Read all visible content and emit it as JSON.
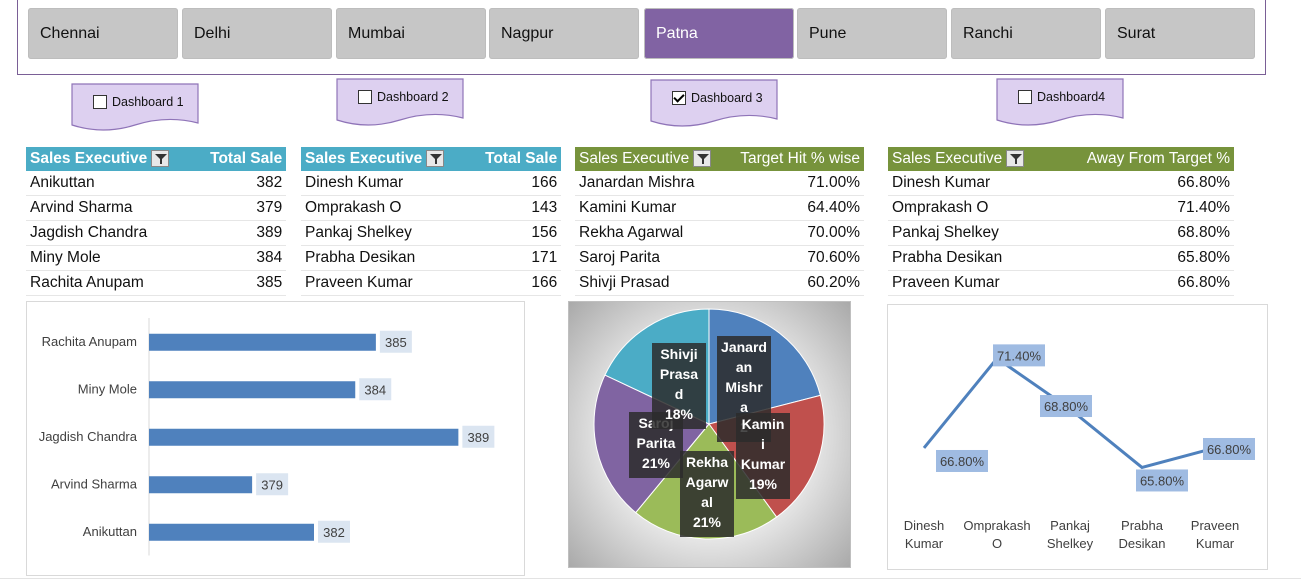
{
  "slicer": {
    "items": [
      "Chennai",
      "Delhi",
      "Mumbai",
      "Nagpur",
      "Patna",
      "Pune",
      "Ranchi",
      "Surat"
    ],
    "selected": "Patna",
    "selected_color": "#8163a3",
    "button_color": "#c6c6c6"
  },
  "dashboards": [
    {
      "label": "Dashboard 1",
      "checked": false
    },
    {
      "label": "Dashboard 2",
      "checked": false
    },
    {
      "label": "Dashboard 3",
      "checked": true
    },
    {
      "label": "Dashboard4",
      "checked": false
    }
  ],
  "tables": [
    {
      "header": [
        "Sales Executive",
        "Total Sale"
      ],
      "header_color": "#4bacc6",
      "rows": [
        [
          "Anikuttan",
          "382"
        ],
        [
          "Arvind Sharma",
          "379"
        ],
        [
          "Jagdish Chandra",
          "389"
        ],
        [
          "Miny Mole",
          "384"
        ],
        [
          "Rachita Anupam",
          "385"
        ]
      ]
    },
    {
      "header": [
        "Sales Executive",
        "Total Sale"
      ],
      "header_color": "#4bacc6",
      "rows": [
        [
          "Dinesh Kumar",
          "166"
        ],
        [
          "Omprakash O",
          "143"
        ],
        [
          "Pankaj Shelkey",
          "156"
        ],
        [
          "Prabha Desikan",
          "171"
        ],
        [
          "Praveen Kumar",
          "166"
        ]
      ]
    },
    {
      "header": [
        "Sales Executive",
        "Target Hit % wise"
      ],
      "header_color": "#77933c",
      "rows": [
        [
          "Janardan Mishra",
          "71.00%"
        ],
        [
          "Kamini Kumar",
          "64.40%"
        ],
        [
          "Rekha Agarwal",
          "70.00%"
        ],
        [
          "Saroj Parita",
          "70.60%"
        ],
        [
          "Shivji Prasad",
          "60.20%"
        ]
      ]
    },
    {
      "header": [
        "Sales Executive",
        "Away From Target %"
      ],
      "header_color": "#77933c",
      "rows": [
        [
          "Dinesh Kumar",
          "66.80%"
        ],
        [
          "Omprakash O",
          "71.40%"
        ],
        [
          "Pankaj Shelkey",
          "68.80%"
        ],
        [
          "Prabha Desikan",
          "65.80%"
        ],
        [
          "Praveen Kumar",
          "66.80%"
        ]
      ]
    }
  ],
  "chart_data": [
    {
      "type": "bar",
      "orientation": "horizontal",
      "categories": [
        "Rachita Anupam",
        "Miny Mole",
        "Jagdish Chandra",
        "Arvind Sharma",
        "Anikuttan"
      ],
      "values": [
        385,
        384,
        389,
        379,
        382
      ],
      "data_labels": [
        "385",
        "384",
        "389",
        "379",
        "382"
      ],
      "bar_color": "#4f81bd",
      "xlim": [
        374,
        390
      ]
    },
    {
      "type": "pie",
      "slices": [
        {
          "label": "Janardan Mishra",
          "label_lines": [
            "Janard",
            "an",
            "Mishr",
            "a",
            "2"
          ],
          "value": 21,
          "color": "#4f81bd"
        },
        {
          "label": "Kamini Kumar",
          "label_lines": [
            "Kamin",
            "i",
            "Kumar",
            "19%"
          ],
          "value": 19,
          "color": "#c0504d"
        },
        {
          "label": "Rekha Agarwal",
          "label_lines": [
            "Rekha",
            "Agarw",
            "al",
            "21%"
          ],
          "value": 21,
          "color": "#9bbb59"
        },
        {
          "label": "Saroj Parita",
          "label_lines": [
            "Saroj",
            "Parita",
            "21%"
          ],
          "value": 21,
          "color": "#8064a2"
        },
        {
          "label": "Shivji Prasad",
          "label_lines": [
            "Shivji",
            "Prasa",
            "d",
            "18%"
          ],
          "value": 18,
          "color": "#4bacc6"
        }
      ]
    },
    {
      "type": "line",
      "categories": [
        "Dinesh Kumar",
        "Omprakash O",
        "Pankaj Shelkey",
        "Prabha Desikan",
        "Praveen Kumar"
      ],
      "category_lines": [
        [
          "Dinesh",
          "Kumar"
        ],
        [
          "Omprakash",
          "O"
        ],
        [
          "Pankaj",
          "Shelkey"
        ],
        [
          "Prabha",
          "Desikan"
        ],
        [
          "Praveen",
          "Kumar"
        ]
      ],
      "values": [
        66.8,
        71.4,
        68.8,
        65.8,
        66.8
      ],
      "data_labels": [
        "66.80%",
        "71.40%",
        "68.80%",
        "65.80%",
        "66.80%"
      ],
      "line_color": "#4f81bd",
      "ylim": [
        64.9,
        72.6
      ]
    }
  ]
}
